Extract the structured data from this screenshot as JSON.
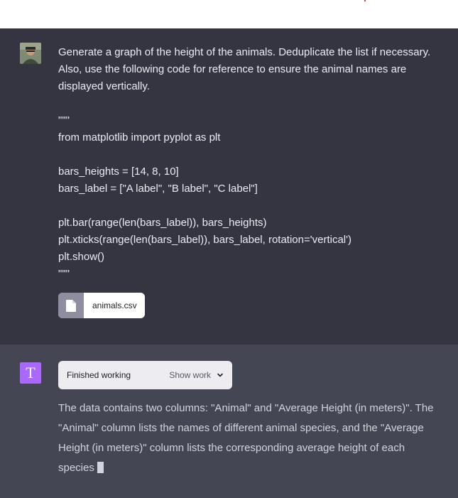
{
  "colors": {
    "user_bg": "#343541",
    "assistant_bg": "#444654",
    "assistant_avatar": "#ab68ff",
    "file_icon_bg": "#8e8ea0"
  },
  "user_message": {
    "avatar_icon": "user-photo-avatar",
    "lines": [
      "Generate a graph of the height of the animals. Deduplicate the list if necessary. Also, use the following code for reference to ensure the animal names are displayed vertically.",
      "",
      "\"\"\"",
      "from matplotlib import pyplot as plt",
      "",
      "bars_heights = [14, 8, 10]",
      "bars_label = [\"A label\", \"B label\", \"C label\"]",
      "",
      "plt.bar(range(len(bars_label)), bars_heights)",
      "plt.xticks(range(len(bars_label)), bars_label, rotation='vertical')",
      "plt.show()",
      "\"\"\""
    ],
    "attachment": {
      "icon": "file-icon",
      "name": "animals.csv"
    }
  },
  "assistant_message": {
    "avatar_letter": "T",
    "status": {
      "label": "Finished working",
      "toggle_label": "Show work",
      "toggle_icon": "chevron-down-icon"
    },
    "text": "The data contains two columns: \"Animal\" and \"Average Height (in meters)\". The \"Animal\" column lists the names of different animal species, and the \"Average Height (in meters)\" column lists the corresponding average height of each species"
  }
}
